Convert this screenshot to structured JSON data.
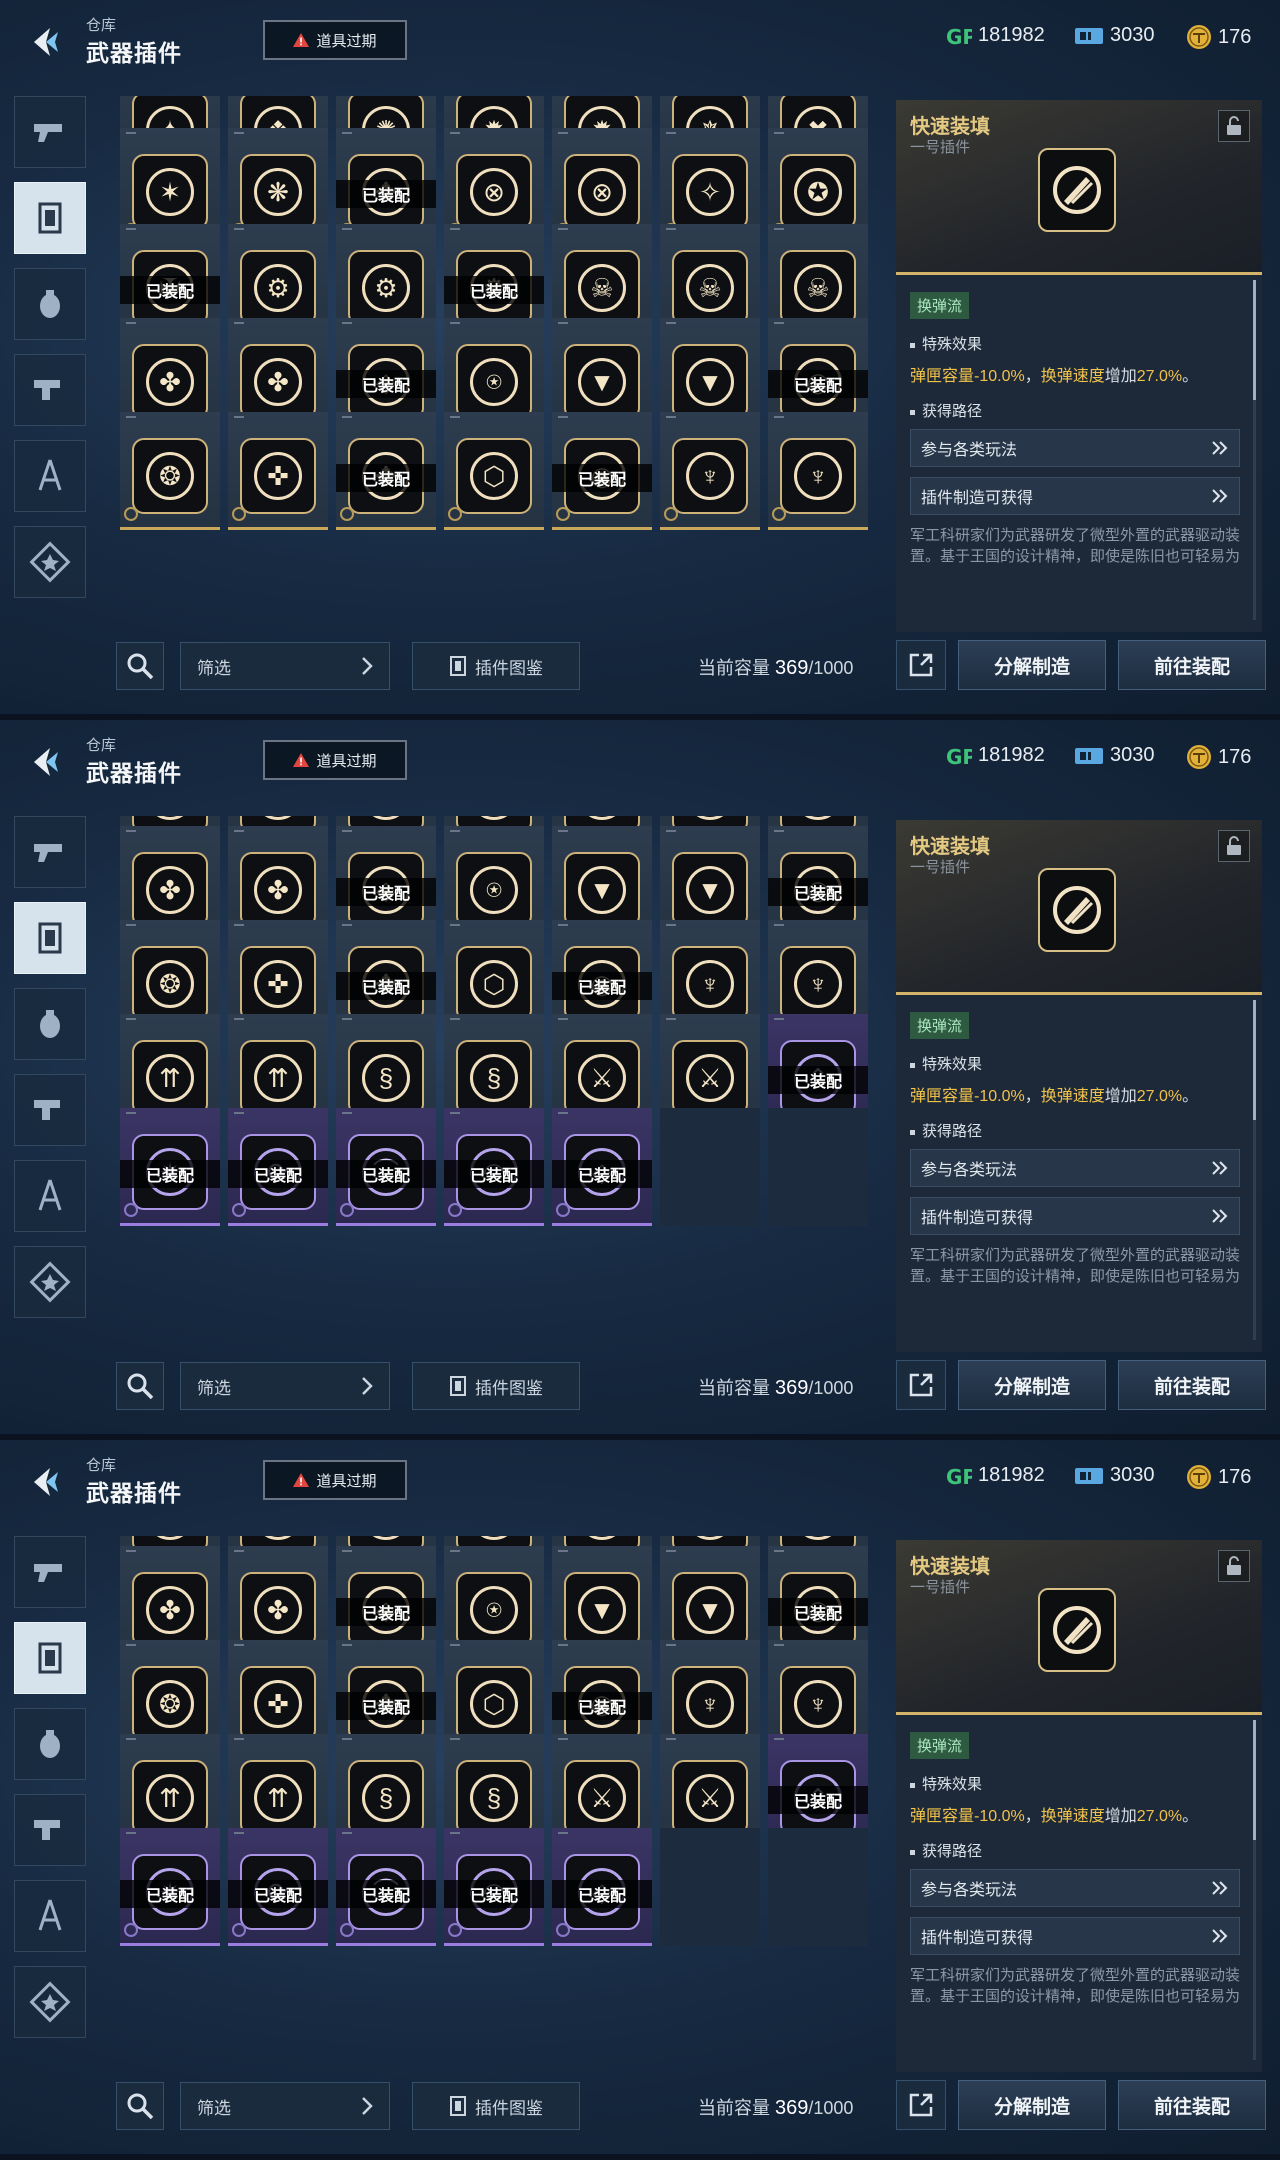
{
  "header": {
    "breadcrumb": "仓库",
    "title": "武器插件",
    "expire_label": "道具过期",
    "currencies": [
      {
        "icon": "gp-icon",
        "value": "181982"
      },
      {
        "icon": "ticket-icon",
        "value": "3030"
      },
      {
        "icon": "coin-icon",
        "value": "176"
      }
    ]
  },
  "sidebar": {
    "items": [
      "pistol-icon",
      "plugin-icon",
      "grenade-icon",
      "gun-part-icon",
      "compass-icon",
      "star-badge-icon"
    ],
    "active_index": 1
  },
  "grid": {
    "equipped_label": "已装配",
    "row_sets": {
      "r1": [
        {
          "g": "✦"
        },
        {
          "g": "❖"
        },
        {
          "g": "✺"
        },
        {
          "g": "✹"
        },
        {
          "g": "✹"
        },
        {
          "g": "✵"
        },
        {
          "g": "✖"
        }
      ],
      "r2": [
        {
          "g": "✶"
        },
        {
          "g": "❋"
        },
        {
          "g": "✥",
          "eq": true
        },
        {
          "g": "⊗"
        },
        {
          "g": "⊗"
        },
        {
          "g": "✧"
        },
        {
          "g": "✪"
        }
      ],
      "r3": [
        {
          "g": "✠",
          "eq": true
        },
        {
          "g": "⚙"
        },
        {
          "g": "⚙"
        },
        {
          "g": "⚙",
          "eq": true
        },
        {
          "g": "☠"
        },
        {
          "g": "☠"
        },
        {
          "g": "☠"
        }
      ],
      "r4": [
        {
          "g": "✤"
        },
        {
          "g": "✤"
        },
        {
          "g": "◈",
          "eq": true
        },
        {
          "g": "⍟"
        },
        {
          "g": "▼"
        },
        {
          "g": "▼"
        },
        {
          "g": "◎",
          "eq": true
        }
      ],
      "r5": [
        {
          "g": "❂"
        },
        {
          "g": "✜"
        },
        {
          "g": "✥",
          "eq": true
        },
        {
          "g": "⬡"
        },
        {
          "g": "◉",
          "eq": true
        },
        {
          "g": "♆"
        },
        {
          "g": "♆"
        }
      ],
      "r6": [
        {
          "g": "⇈"
        },
        {
          "g": "⇈"
        },
        {
          "g": "§"
        },
        {
          "g": "§"
        },
        {
          "g": "⚔"
        },
        {
          "g": "⚔"
        },
        {
          "g": "⌃",
          "eq": true,
          "p": true
        }
      ],
      "r7": [
        {
          "g": "✷",
          "eq": true,
          "p": true
        },
        {
          "g": "⟳",
          "eq": true,
          "p": true
        },
        {
          "g": "⌒",
          "eq": true,
          "p": true
        },
        {
          "g": "◠",
          "eq": true,
          "p": true
        },
        {
          "g": "◇",
          "eq": true,
          "p": true
        },
        {
          "e": true
        },
        {
          "e": true
        }
      ]
    }
  },
  "bottom": {
    "filter_label": "筛选",
    "codex_label": "插件图鉴",
    "capacity_label": "当前容量",
    "capacity_used": "369",
    "capacity_total": "/1000",
    "disassemble_label": "分解制造",
    "equip_label": "前往装配"
  },
  "detail": {
    "name": "快速装填",
    "subtitle": "一号插件",
    "tag": "换弹流",
    "effect_title": "特殊效果",
    "effect_a": "弹匣容量-10.0%",
    "effect_sep": "，",
    "effect_b": "换弹速度",
    "effect_mid": "增加",
    "effect_c": "27.0%",
    "effect_end": "。",
    "source_title": "获得路径",
    "sources": [
      "参与各类玩法",
      "插件制造可获得"
    ],
    "description": "军工科研家们为武器研发了微型外置的武器驱动装置。基于王国的设计精神，即使是陈旧也可轻易为"
  },
  "colors": {
    "gold": "#d4b36a",
    "purple": "#9b7de0",
    "effect": "#f0c24a",
    "tag_green": "#2f5a42"
  }
}
